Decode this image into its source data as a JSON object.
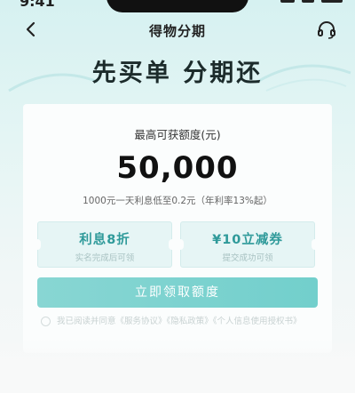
{
  "status": {
    "time": "9:41"
  },
  "nav": {
    "title": "得物分期",
    "back_icon": "chevron-left-icon",
    "service_icon": "headset-icon"
  },
  "hero": {
    "title": "先买单 分期还"
  },
  "card": {
    "limit_label": "最高可获额度(元)",
    "limit_amount": "50,000",
    "limit_note": "1000元一天利息低至0.2元（年利率13%起）"
  },
  "perks": [
    {
      "title": "利息8折",
      "subtitle": "实名完成后可领"
    },
    {
      "title": "¥10立减券",
      "subtitle": "提交成功可领"
    }
  ],
  "apply_button": {
    "label": "立即领取额度"
  },
  "agreement": {
    "text": "我已阅读并同意《服务协议》《隐私政策》《个人信息使用授权书》"
  },
  "colors": {
    "accent": "#2f9a9a",
    "button": "#7fd3d0",
    "background": "#d6f1f1"
  }
}
